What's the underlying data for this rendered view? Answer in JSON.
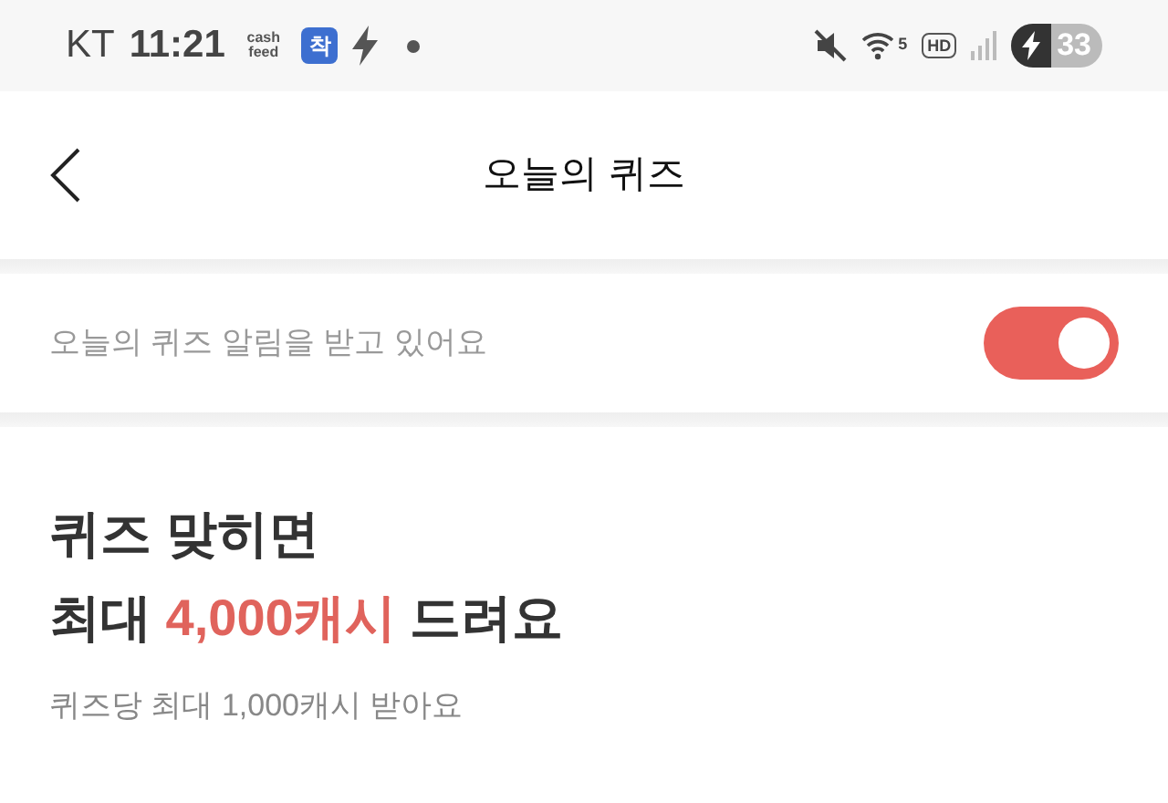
{
  "status_bar": {
    "carrier": "KT",
    "time": "11:21",
    "app_icons": [
      {
        "kind": "cashfeed",
        "text": "cash feed"
      },
      {
        "kind": "badge",
        "text": "착"
      },
      {
        "kind": "bolt"
      },
      {
        "kind": "dot"
      }
    ],
    "wifi_label": "5",
    "hd_label": "HD",
    "battery": "33",
    "muted": true
  },
  "header": {
    "title": "오늘의 퀴즈"
  },
  "notification": {
    "label": "오늘의 퀴즈 알림을 받고 있어요",
    "on": true
  },
  "promo": {
    "line_1": "퀴즈 맞히면",
    "line_2": {
      "before": "최대 ",
      "highlight": "4,000캐시",
      "after": " 드려요"
    },
    "subtitle": "퀴즈당 최대 1,000캐시 받아요"
  }
}
